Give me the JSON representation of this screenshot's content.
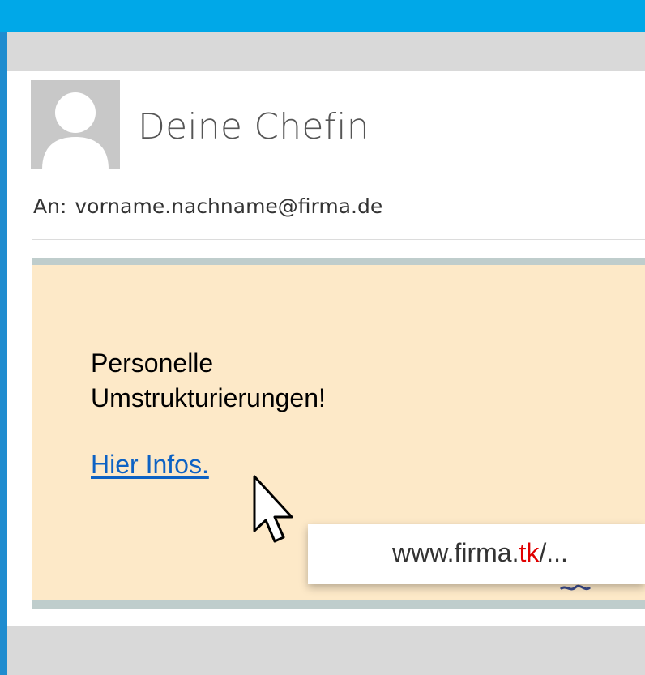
{
  "sender": {
    "name": "Deine Chefin",
    "avatar_icon": "person-silhouette-icon"
  },
  "recipient": {
    "label": "An:",
    "address": "vorname.nachname@firma.de"
  },
  "message": {
    "headline_line1": "Personelle",
    "headline_line2": "Umstrukturierungen!",
    "link_text": "Hier Infos."
  },
  "link_tooltip": {
    "url_prefix": "www.firma.",
    "url_tld": "tk",
    "url_suffix": "/..."
  },
  "colors": {
    "top_bar": "#00a8e8",
    "side_border": "#1f8ccf",
    "body_background": "#fde9c8",
    "link": "#0d62c4",
    "suspicious_tld": "#e00000"
  }
}
